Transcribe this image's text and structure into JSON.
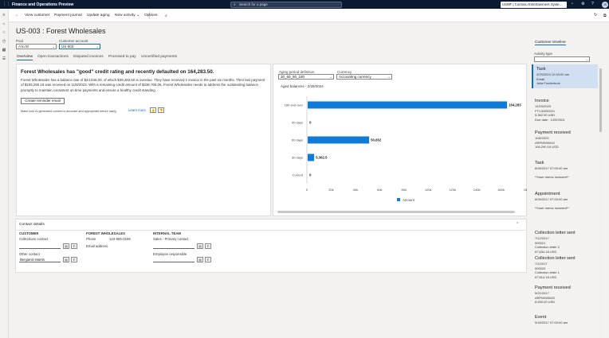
{
  "topbar": {
    "app_title": "Finance and Operations Preview",
    "search_placeholder": "Search for a page",
    "company": "USMF | Contoso Entertainment Syste...",
    "avatar": "JS"
  },
  "actionbar": {
    "view_customer": "View customer",
    "payment_journal": "Payment journal",
    "update_aging": "Update aging",
    "new_activity": "New activity",
    "options": "Options"
  },
  "page": {
    "title": "US-003 : Forest Wholesales"
  },
  "filters": {
    "pool_label": "Pool",
    "pool_value": "A to M",
    "account_label": "Customer account",
    "account_value": "US-003"
  },
  "tabs": [
    "Overview",
    "Open transactions",
    "Disputed invoices",
    "Promised to pay",
    "Uncertified payments"
  ],
  "summary": {
    "heading": "Forest Wholesales has \"good\" credit rating and recently defaulted on 164,283.50.",
    "body": "Forest Wholesales has a balance due of $44,646.00, of which $39,283.50 is overdue. They have received 1 invoice in the past six months. Their last payment of $106,290.18 was received on 11/8/2023. With a remaining credit amount of $338,766.05, Forest Wholesales needs to address the outstanding balance promptly to maintain consistent on-time payments and ensure a healthy credit standing.",
    "button": "Create reminder email",
    "note": "Make sure AI-generated content is accurate and appropriate before using.",
    "learn_more": "Learn more"
  },
  "aging": {
    "period_label": "Aging period definition",
    "period_value": "30_60_90_180",
    "currency_label": "Currency",
    "currency_value": "Accounting currency"
  },
  "chart_data": {
    "type": "bar",
    "orientation": "horizontal",
    "title": "Aged balances - 2/28/2024",
    "categories": [
      "180 and over",
      "90 days",
      "60 days",
      "30 days",
      "Current"
    ],
    "series": [
      {
        "name": "Amount",
        "values": [
          164283,
          0,
          50652,
          5362.5,
          0
        ]
      }
    ],
    "value_labels": [
      "164,283",
      "0",
      "50,652",
      "5,362.5",
      "0"
    ],
    "xlim": [
      0,
      180000
    ],
    "x_ticks": [
      "0",
      "20k",
      "40k",
      "60k",
      "80k",
      "100k",
      "120k",
      "140k",
      "160k",
      "18"
    ],
    "bar_color": "#0f7bd7",
    "legend": "bottom"
  },
  "contact": {
    "heading": "Contact details",
    "customer_h": "CUSTOMER",
    "collections_contact": "Collections contact",
    "other_contact": "Other contact",
    "other_contact_value": "Benjamin Martin",
    "forest_h": "FOREST WHOLESALES",
    "phone_label": "Phone",
    "phone_value": "123-555-0159",
    "email_label": "Email address",
    "internal_h": "INTERNAL TEAM",
    "sales_contact": "Sales - Primary contact",
    "employee_resp": "Employee responsible"
  },
  "timeline": {
    "header": "Customer timeline",
    "activity_type": "Activity type",
    "items": [
      {
        "title": "Task",
        "lines": [
          "2/29/2024 12:00:00 am",
          "Email",
          "Julia Funderburk"
        ]
      },
      {
        "title": "Invoice",
        "lines": [
          "12/15/2023",
          "FTI-00000021",
          "5,362.50 USD",
          "Due date : 1/29/2024"
        ]
      },
      {
        "title": "Payment received",
        "lines": [
          "11/8/2023",
          "ARPM000610",
          "106,290.18 USD"
        ]
      },
      {
        "title": "Task",
        "lines": [
          "8/26/2017 07:00:00 am",
          "",
          "**User memo included**"
        ]
      },
      {
        "title": "Appointment",
        "lines": [
          "8/26/2017 07:00:00 am",
          "",
          "**User memo included**"
        ]
      },
      {
        "title": "Collection letter sent",
        "lines": [
          "7/12/2017",
          "000021",
          "Collection letter 2",
          "67,834.18 USD"
        ]
      },
      {
        "title": "Collection letter sent",
        "lines": [
          "7/1/2017",
          "000020",
          "Collection letter 1",
          "67,814.18 USD"
        ]
      },
      {
        "title": "Payment received",
        "lines": [
          "5/21/2017",
          "ARPM000620",
          "8,590.00 USD"
        ]
      },
      {
        "title": "Event",
        "lines": [
          "5/18/2017 07:00:00 am"
        ]
      }
    ]
  }
}
